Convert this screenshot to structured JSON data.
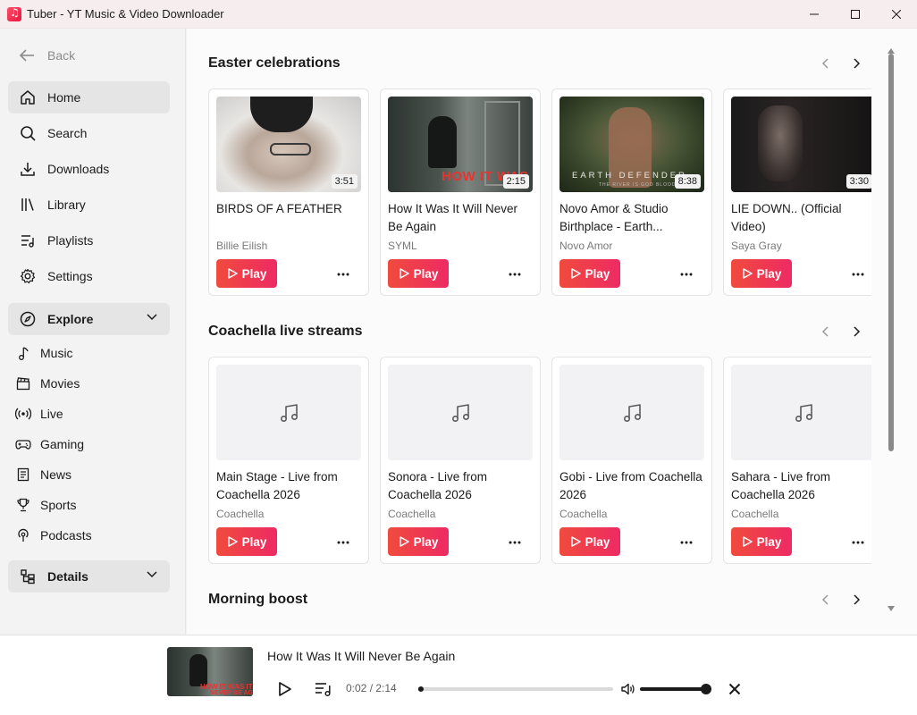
{
  "window": {
    "title": "Tuber - YT Music & Video Downloader"
  },
  "sidebar": {
    "back_label": "Back",
    "items": [
      {
        "label": "Home",
        "icon": "home-icon"
      },
      {
        "label": "Search",
        "icon": "search-icon"
      },
      {
        "label": "Downloads",
        "icon": "download-icon"
      },
      {
        "label": "Library",
        "icon": "library-icon"
      },
      {
        "label": "Playlists",
        "icon": "playlist-icon"
      },
      {
        "label": "Settings",
        "icon": "gear-icon"
      }
    ],
    "explore": {
      "label": "Explore",
      "items": [
        {
          "label": "Music",
          "icon": "music-note-icon"
        },
        {
          "label": "Movies",
          "icon": "clapperboard-icon"
        },
        {
          "label": "Live",
          "icon": "live-broadcast-icon"
        },
        {
          "label": "Gaming",
          "icon": "gamepad-icon"
        },
        {
          "label": "News",
          "icon": "newspaper-icon"
        },
        {
          "label": "Sports",
          "icon": "trophy-icon"
        },
        {
          "label": "Podcasts",
          "icon": "podcast-icon"
        }
      ]
    },
    "details_label": "Details"
  },
  "sections": [
    {
      "title": "Easter celebrations",
      "cards": [
        {
          "title": "BIRDS OF A FEATHER",
          "artist": "Billie Eilish",
          "duration": "3:51",
          "play_label": "Play"
        },
        {
          "title": "How It Was It Will Never Be Again",
          "artist": "SYML",
          "duration": "2:15",
          "play_label": "Play",
          "thumb_text": "HOW IT WAS"
        },
        {
          "title": "Novo Amor & Studio Birthplace - Earth...",
          "artist": "Novo Amor",
          "duration": "8:38",
          "play_label": "Play",
          "thumb_text": "EARTH DEFENDER",
          "thumb_subtext": "THE RIVER IS GOD BLOOD"
        },
        {
          "title": "LIE DOWN.. (Official Video)",
          "artist": "Saya Gray",
          "duration": "3:30",
          "play_label": "Play"
        }
      ]
    },
    {
      "title": "Coachella live streams",
      "cards": [
        {
          "title": "Main Stage - Live from Coachella 2026",
          "artist": "Coachella",
          "play_label": "Play"
        },
        {
          "title": "Sonora - Live from Coachella 2026",
          "artist": "Coachella",
          "play_label": "Play"
        },
        {
          "title": "Gobi - Live from Coachella 2026",
          "artist": "Coachella",
          "play_label": "Play"
        },
        {
          "title": "Sahara - Live from Coachella 2026",
          "artist": "Coachella",
          "play_label": "Play"
        }
      ]
    },
    {
      "title": "Morning boost",
      "cards": []
    }
  ],
  "player": {
    "title": "How It Was It Will Never Be Again",
    "thumb_text": "HOW IT WAS IT",
    "thumb_subtext": "NEVER BE AG",
    "time": "0:02 / 2:14",
    "progress": 0.015,
    "volume": 1.0
  },
  "colors": {
    "accent_start": "#f04b3d",
    "accent_end": "#ee2a63"
  }
}
